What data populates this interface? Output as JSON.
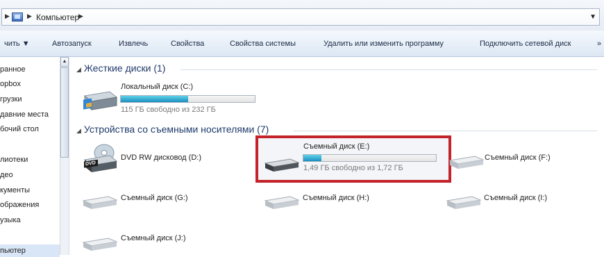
{
  "address": {
    "path": "Компьютер"
  },
  "toolbar": {
    "items": [
      "чить ▼",
      "Автозапуск",
      "Извлечь",
      "Свойства",
      "Свойства системы",
      "Удалить или изменить программу",
      "Подключить сетевой диск",
      "»"
    ]
  },
  "sidebar": {
    "items": [
      "ранное",
      "opbox",
      "грузки",
      "давние места",
      "бочий стол",
      "лиотеки",
      "део",
      "кументы",
      "ображения",
      "узыка",
      "пьютер"
    ],
    "split_marker": "≡"
  },
  "groups": {
    "hard": {
      "title": "Жесткие диски (1)"
    },
    "removable": {
      "title": "Устройства со съемными носителями (7)"
    }
  },
  "drives": {
    "c": {
      "name": "Локальный диск (C:)",
      "free": "115 ГБ свободно из 232 ГБ",
      "used_fraction": 0.504
    },
    "d": {
      "name": "DVD RW дисковод (D:)",
      "badge": "DVD"
    },
    "e": {
      "name": "Съемный диск (E:)",
      "free": "1,49 ГБ свободно из 1,72 ГБ",
      "used_fraction": 0.134
    },
    "f": {
      "name": "Съемный диск (F:)"
    },
    "g": {
      "name": "Съемный диск (G:)"
    },
    "h": {
      "name": "Съемный диск (H:)"
    },
    "i": {
      "name": "Съемный диск (I:)"
    },
    "j": {
      "name": "Съемный диск (J:)"
    }
  },
  "colors": {
    "highlight": "#c4232a",
    "bar_fill": "#1a8fbf"
  }
}
